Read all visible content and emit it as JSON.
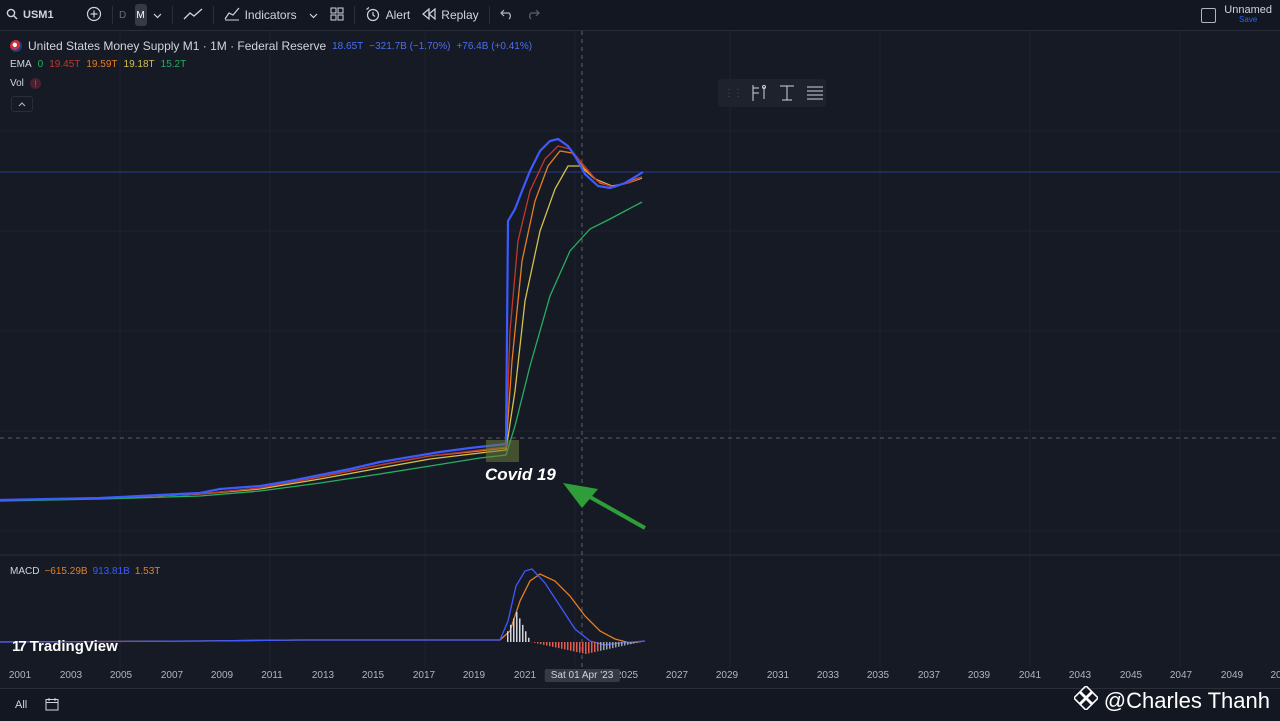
{
  "topbar": {
    "symbol": "USM1",
    "interval_d": "D",
    "interval_m": "M",
    "indicators_label": "Indicators",
    "alert_label": "Alert",
    "replay_label": "Replay",
    "layout_name": "Unnamed",
    "save_label": "Save"
  },
  "legend": {
    "title": "United States Money Supply M1 · 1M · Federal Reserve",
    "last": "18.65T",
    "change": "−321.7B (−1.70%)",
    "change2": "+76.4B (+0.41%)",
    "ema_label": "EMA",
    "ema_zero": "0",
    "ema_v1": "19.45T",
    "ema_v2": "19.59T",
    "ema_v3": "19.18T",
    "ema_v4": "15.2T",
    "vol_label": "Vol",
    "macd_label": "MACD",
    "macd_v1": "−615.29B",
    "macd_v2": "913.81B",
    "macd_v3": "1.53T"
  },
  "annotation": {
    "text": "Covid 19"
  },
  "xaxis": {
    "labels": [
      "2001",
      "2003",
      "2005",
      "2007",
      "2009",
      "2011",
      "2013",
      "2015",
      "2017",
      "2019",
      "2021",
      "2025",
      "2027",
      "2029",
      "2031",
      "2033",
      "2035",
      "2037",
      "2039",
      "2041",
      "2043",
      "2045",
      "2047",
      "2049",
      "20"
    ],
    "crosshair_date": "Sat 01 Apr '23"
  },
  "branding": {
    "tradingview": "TradingView"
  },
  "bottombar": {
    "all_label": "All"
  },
  "watermark": {
    "text": "@Charles Thanh"
  },
  "colors": {
    "price": "#3d5afe",
    "ema_red": "#c0392b",
    "ema_orange": "#e67e22",
    "ema_yellow": "#d4c04a",
    "ema_green": "#27ae60",
    "arrow": "#2e9d3a"
  },
  "chart_data": {
    "type": "line",
    "x": [
      2000,
      2008,
      2010,
      2012,
      2014,
      2016,
      2018,
      2019.9,
      2020.1,
      2020.6,
      2021.0,
      2021.6,
      2022.2,
      2022.8,
      2023.4,
      2024.0,
      2024.6
    ],
    "series": [
      {
        "values": [
          1.1,
          1.4,
          1.7,
          2.3,
          2.8,
          3.3,
          3.7,
          3.9,
          16.0,
          18.2,
          19.6,
          20.6,
          20.3,
          19.0,
          18.3,
          18.4,
          18.65
        ]
      }
    ],
    "ylim": [
      0,
      21
    ]
  }
}
